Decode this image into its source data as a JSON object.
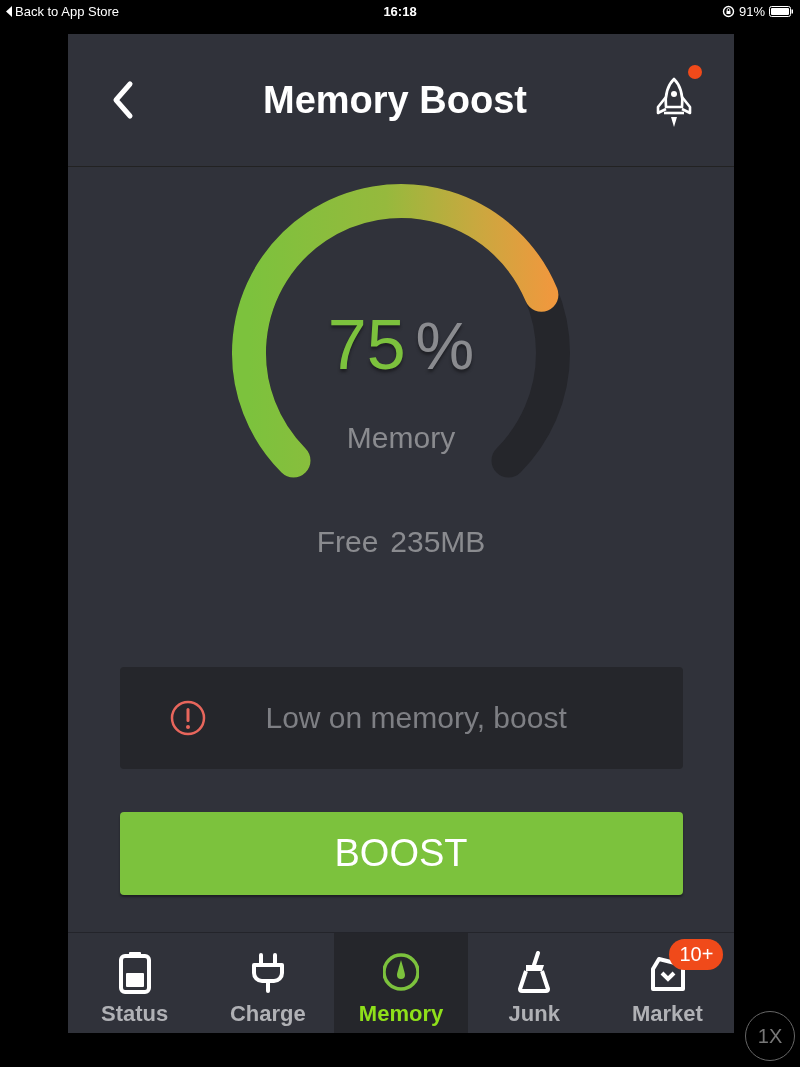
{
  "status_bar": {
    "back_label": "Back to App Store",
    "time": "16:18",
    "battery_percent": "91%"
  },
  "header": {
    "title": "Memory Boost",
    "notification": true
  },
  "gauge": {
    "value": "75",
    "unit": "%",
    "label": "Memory"
  },
  "free": {
    "label": "Free",
    "value": "235MB"
  },
  "alert": {
    "message": "Low on memory, boost"
  },
  "boost_button": {
    "label": "BOOST"
  },
  "tabs": [
    {
      "label": "Status",
      "selected": false
    },
    {
      "label": "Charge",
      "selected": false
    },
    {
      "label": "Memory",
      "selected": true
    },
    {
      "label": "Junk",
      "selected": false
    },
    {
      "label": "Market",
      "selected": false,
      "badge": "10+"
    }
  ],
  "zoom_button": {
    "label": "1X"
  }
}
